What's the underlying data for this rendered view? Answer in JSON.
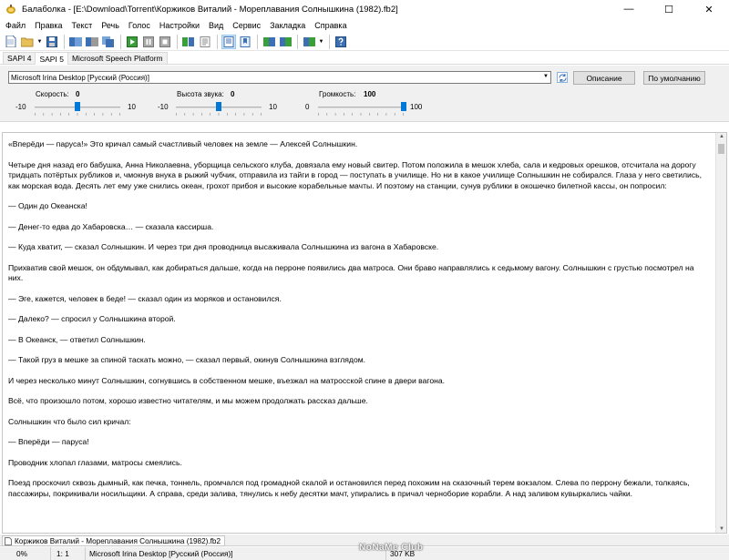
{
  "window": {
    "title": "Балаболка - [E:\\Download\\Torrent\\Коржиков Виталий - Мореплавания Солнышкина (1982).fb2]",
    "minimize_glyph": "—",
    "maximize_glyph": "☐",
    "close_glyph": "✕"
  },
  "menu": [
    "Файл",
    "Правка",
    "Текст",
    "Речь",
    "Голос",
    "Настройки",
    "Вид",
    "Сервис",
    "Закладка",
    "Справка"
  ],
  "tabs": [
    {
      "label": "SAPI 4",
      "active": false
    },
    {
      "label": "SAPI 5",
      "active": true
    },
    {
      "label": "Microsoft Speech Platform",
      "active": false
    }
  ],
  "voice": {
    "selected": "Microsoft Irina Desktop [Русский (Россия)]",
    "describe_label": "Описание",
    "default_label": "По умолчанию"
  },
  "sliders": {
    "rate": {
      "label": "Скорость:",
      "value": "0",
      "min": "-10",
      "max": "10",
      "position": 0.5
    },
    "pitch": {
      "label": "Высота звука:",
      "value": "0",
      "min": "-10",
      "max": "10",
      "position": 0.5
    },
    "volume": {
      "label": "Громкость:",
      "value": "100",
      "min": "0",
      "max": "100",
      "position": 1.0
    }
  },
  "text": {
    "paragraphs": [
      "«Вперёди — паруса!» Это кричал самый счастливый человек на земле — Алексей Солнышкин.",
      "Четыре дня назад его бабушка, Анна Николаевна, уборщица сельского клуба, довязала ему новый свитер. Потом положила в мешок хлеба, сала и кедровых орешков, отсчитала на дорогу тридцать потёртых рубликов и, чмокнув внука в рыжий чубчик, отправила из тайги в город — поступать в училище. Но ни в какое училище Солнышкин не собирался. Глаза у него светились, как морская вода. Десять лет ему уже снились океан, грохот прибоя и высокие корабельные мачты. И поэтому на станции, сунув рублики в окошечко билетной кассы, он попросил:",
      "— Один до Океанска!",
      "— Денег-то едва до Хабаровска… — сказала кассирша.",
      "— Куда хватит, — сказал Солнышкин. И через три дня проводница высаживала Солнышкина из вагона в Хабаровске.",
      "Прихватив свой мешок, он обдумывал, как добираться дальше, когда на перроне появились два матроса. Они браво направлялись к седьмому вагону. Солнышкин с грустью посмотрел на них.",
      "— Эге, кажется, человек в беде! — сказал один из моряков и остановился.",
      "— Далеко? — спросил у Солнышкина второй.",
      "— В Океанск, — ответил Солнышкин.",
      "— Такой груз в мешке за спиной таскать можно, — сказал первый, окинув Солнышкина взглядом.",
      "И через несколько минут Солнышкин, согнувшись в собственном мешке, въезжал на матросской спине в двери вагона.",
      "Всё, что произошло потом, хорошо известно читателям, и мы можем продолжать рассказ дальше.",
      "Солнышкин что было сил кричал:",
      "— Вперёди — паруса!",
      "Проводник хлопал глазами, матросы смеялись.",
      "Поезд проскочил сквозь дымный, как печка, тоннель, промчался под громадной скалой и остановился перед похожим на сказочный терем вокзалом. Слева по перрону бежали, толкаясь, пассажиры, покрикивали носильщики. А справа, среди залива, тянулись к небу десятки мачт, упирались в причал черноборие корабли. А над заливом кувыркались чайки."
    ]
  },
  "document_tab": "Коржиков Виталий - Мореплавания Солнышкина (1982).fb2",
  "status": {
    "percent": "0%",
    "position": "1:   1",
    "voice": "Microsoft Irina Desktop [Русский (Россия)]",
    "size": "307 KB",
    "watermark": "NoNaMe Club"
  },
  "colors": {
    "accent": "#0078d7",
    "panel": "#f0f0f0"
  }
}
